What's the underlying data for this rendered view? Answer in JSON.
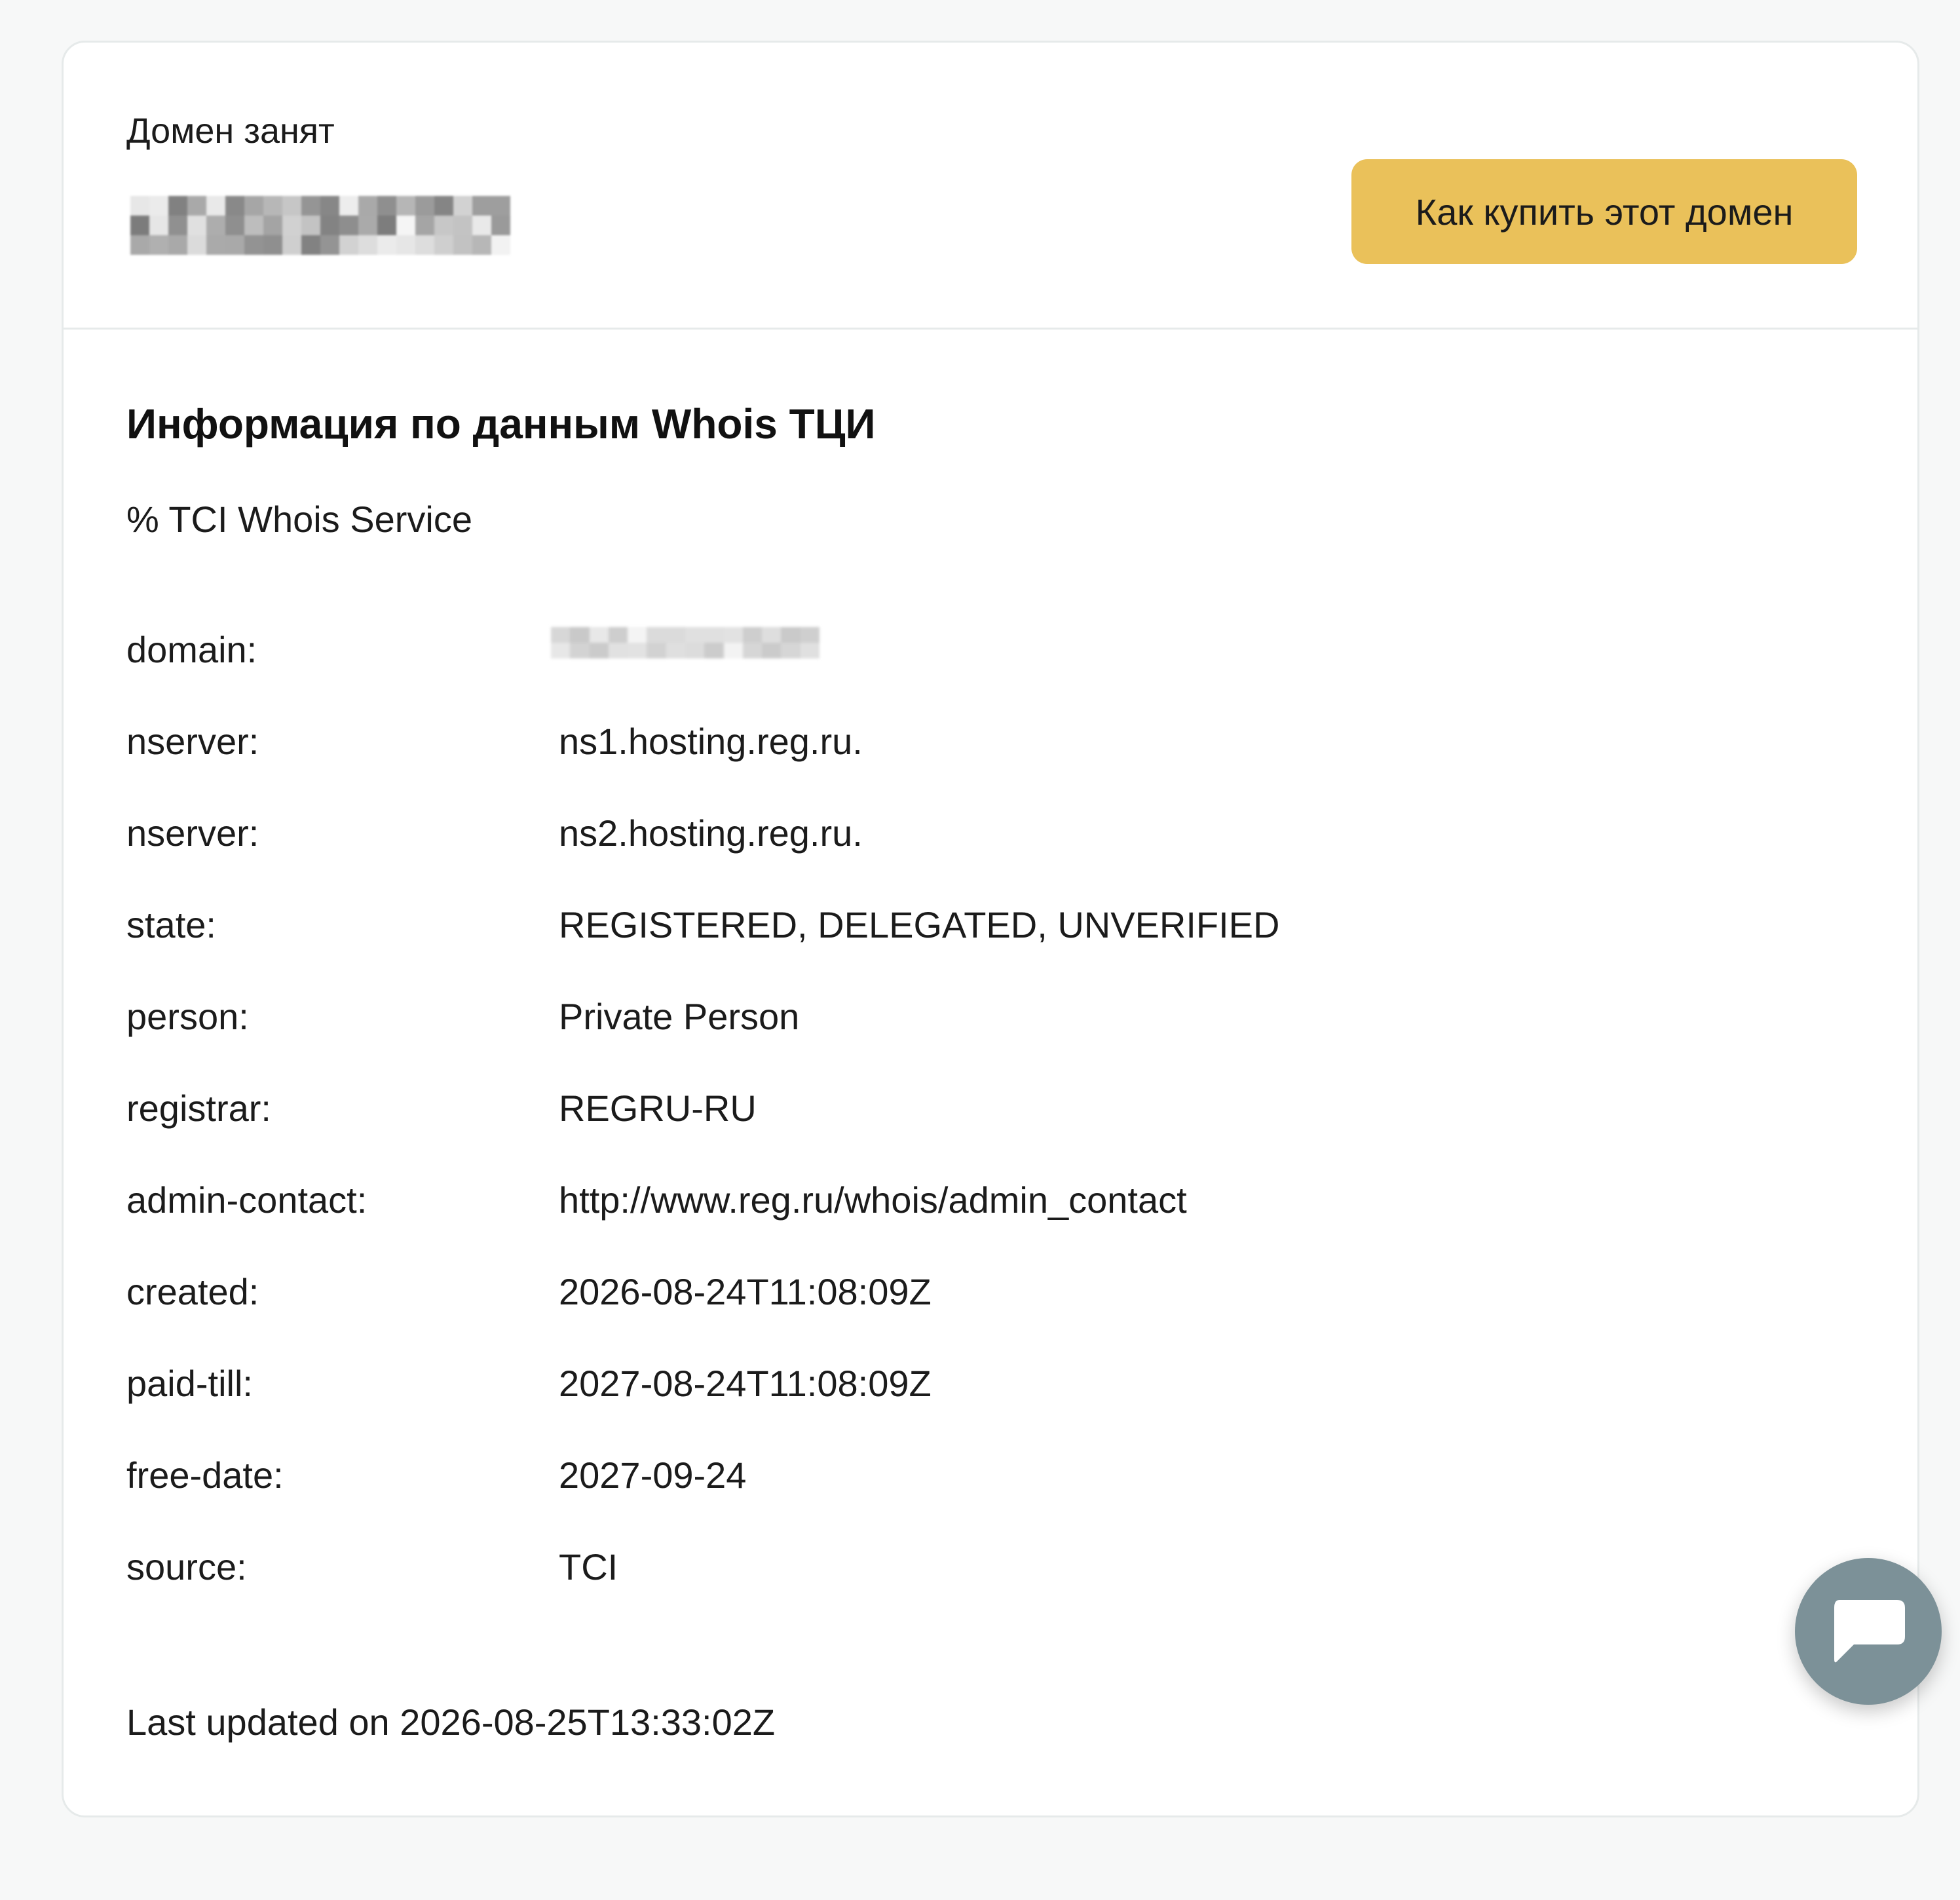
{
  "header": {
    "status_label": "Домен занят",
    "buy_button_label": "Как купить этот домен"
  },
  "whois": {
    "title": "Информация по данным Whois ТЦИ",
    "service_line": "% TCI Whois Service",
    "rows": [
      {
        "key": "domain:",
        "value": ""
      },
      {
        "key": "nserver:",
        "value": "ns1.hosting.reg.ru."
      },
      {
        "key": "nserver:",
        "value": "ns2.hosting.reg.ru."
      },
      {
        "key": "state:",
        "value": "REGISTERED, DELEGATED, UNVERIFIED"
      },
      {
        "key": "person:",
        "value": "Private Person"
      },
      {
        "key": "registrar:",
        "value": "REGRU-RU"
      },
      {
        "key": "admin-contact:",
        "value": "http://www.reg.ru/whois/admin_contact"
      },
      {
        "key": "created:",
        "value": "2026-08-24T11:08:09Z"
      },
      {
        "key": "paid-till:",
        "value": "2027-08-24T11:08:09Z"
      },
      {
        "key": "free-date:",
        "value": "2027-09-24"
      },
      {
        "key": "source:",
        "value": "TCI"
      }
    ],
    "last_updated": "Last updated on 2026-08-25T13:33:02Z"
  },
  "chat": {
    "icon": "chat-bubble-icon"
  },
  "colors": {
    "accent_button": "#eac15a",
    "chat_button": "#7c9198",
    "page_background": "#f7f8f8",
    "card_border": "#e6eaea"
  }
}
